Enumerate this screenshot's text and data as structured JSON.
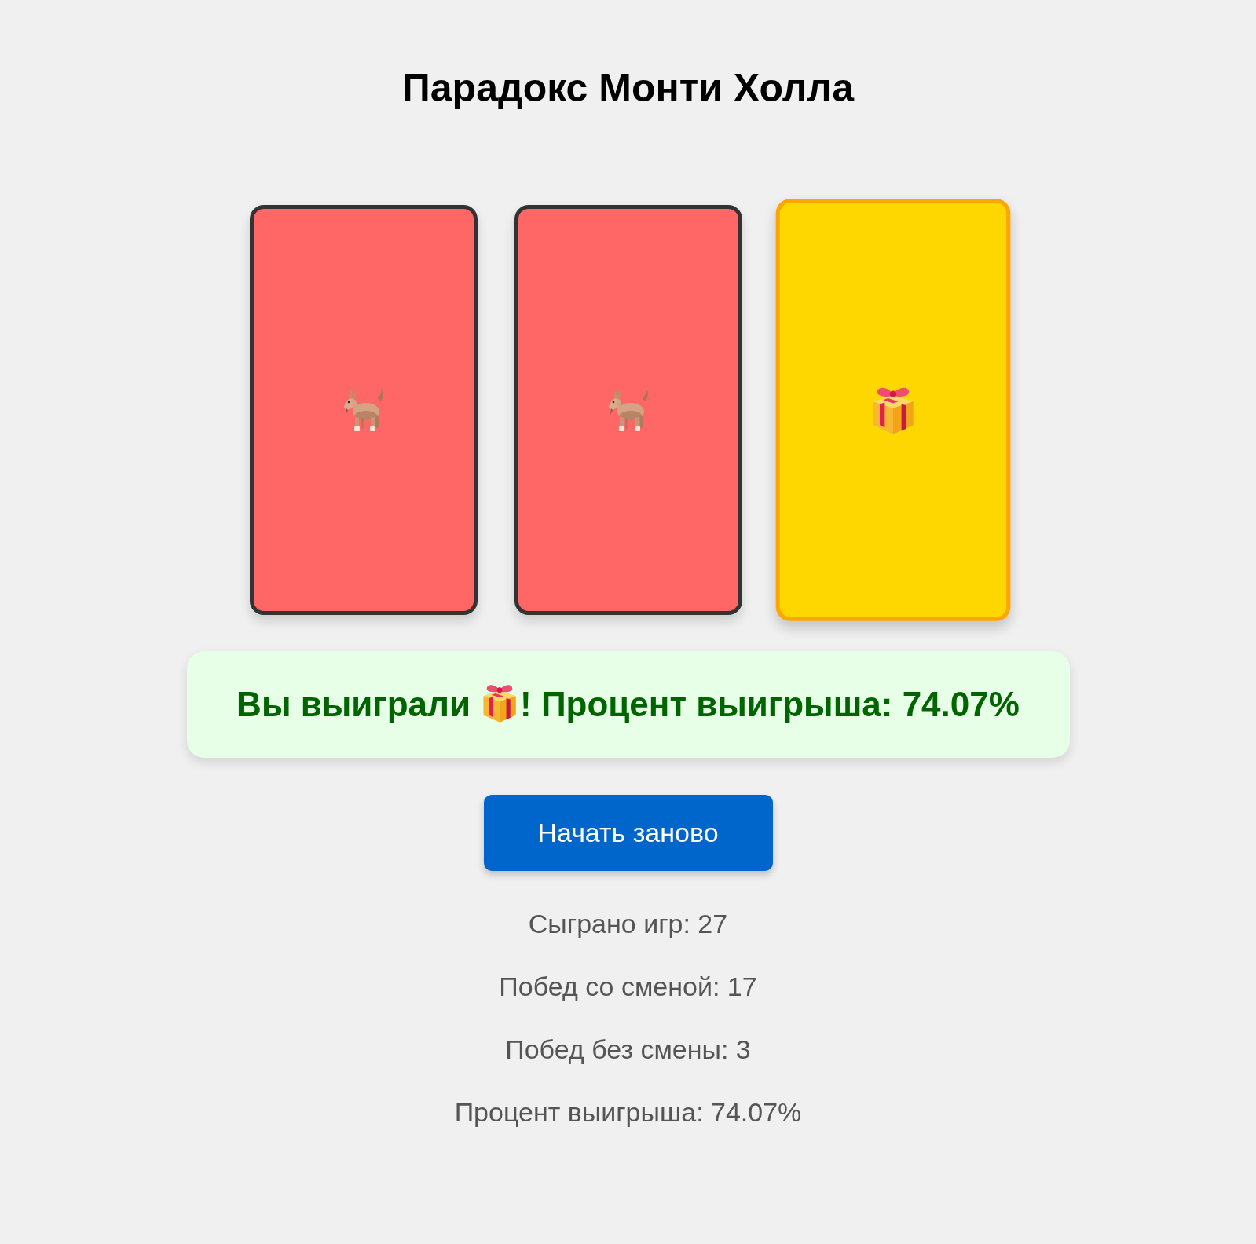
{
  "title": "Парадокс Монти Холла",
  "doors": [
    {
      "kind": "goat",
      "selected": false
    },
    {
      "kind": "goat",
      "selected": false
    },
    {
      "kind": "gift",
      "selected": true
    }
  ],
  "result": {
    "parts": [
      {
        "kind": "text",
        "text": "Вы выиграли"
      },
      {
        "kind": "gift"
      },
      {
        "kind": "text",
        "text": "! Процент выигрыша: 74.07%"
      }
    ]
  },
  "restart_button": {
    "label": "Начать заново"
  },
  "stats": [
    "Сыграно игр: 27",
    "Побед со сменой: 17",
    "Побед без смены: 3",
    "Процент выигрыша: 74.07%"
  ]
}
